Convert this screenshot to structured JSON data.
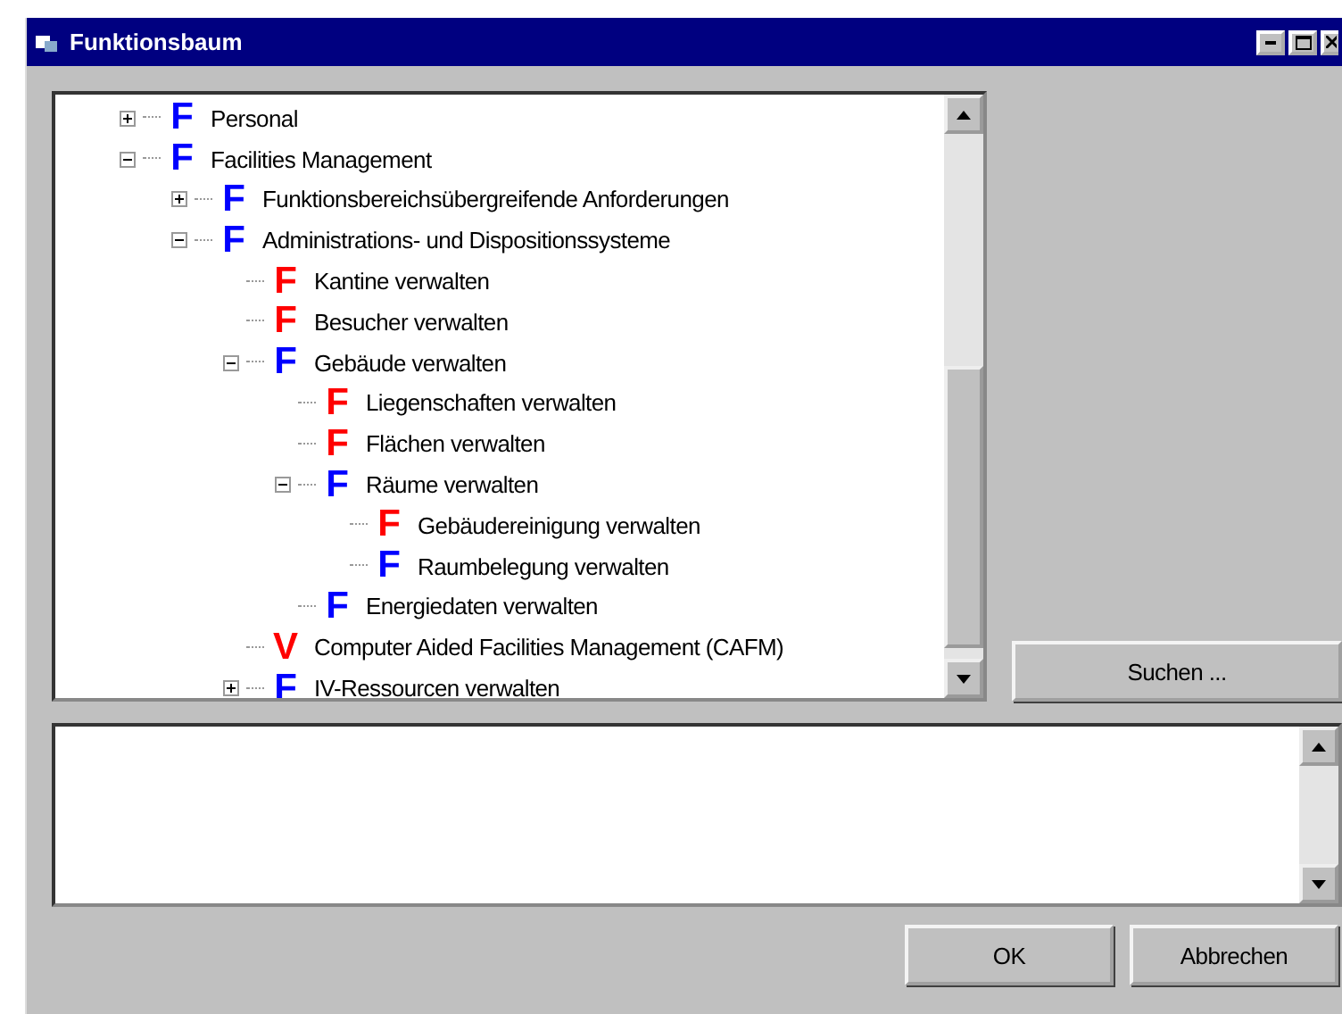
{
  "window": {
    "title": "Funktionsbaum"
  },
  "tree": [
    {
      "label": "Personal",
      "icon": "F",
      "color": "#0000ff",
      "expanded": false
    },
    {
      "label": "Facilities Management",
      "icon": "F",
      "color": "#0000ff",
      "expanded": true,
      "children": [
        {
          "label": "Funktionsbereichsübergreifende Anforderungen",
          "icon": "F",
          "color": "#0000ff",
          "expanded": false
        },
        {
          "label": "Administrations- und Dispositionssysteme",
          "icon": "F",
          "color": "#0000ff",
          "expanded": true,
          "children": [
            {
              "label": "Kantine verwalten",
              "icon": "F",
              "color": "#ff0000"
            },
            {
              "label": "Besucher verwalten",
              "icon": "F",
              "color": "#ff0000"
            },
            {
              "label": "Gebäude verwalten",
              "icon": "F",
              "color": "#0000ff",
              "expanded": true,
              "children": [
                {
                  "label": "Liegenschaften verwalten",
                  "icon": "F",
                  "color": "#ff0000"
                },
                {
                  "label": "Flächen verwalten",
                  "icon": "F",
                  "color": "#ff0000"
                },
                {
                  "label": "Räume verwalten",
                  "icon": "F",
                  "color": "#0000ff",
                  "expanded": true,
                  "children": [
                    {
                      "label": "Gebäudereinigung verwalten",
                      "icon": "F",
                      "color": "#ff0000"
                    },
                    {
                      "label": "Raumbelegung verwalten",
                      "icon": "F",
                      "color": "#0000ff"
                    }
                  ]
                },
                {
                  "label": "Energiedaten verwalten",
                  "icon": "F",
                  "color": "#0000ff"
                }
              ]
            },
            {
              "label": "Computer Aided Facilities Management (CAFM)",
              "icon": "V",
              "color": "#ff0000"
            },
            {
              "label": "IV-Ressourcen verwalten",
              "icon": "F",
              "color": "#0000ff",
              "expanded": false
            }
          ]
        }
      ]
    }
  ],
  "search_button": "Suchen ...",
  "buttons": [
    "OK",
    "Abbrechen"
  ]
}
